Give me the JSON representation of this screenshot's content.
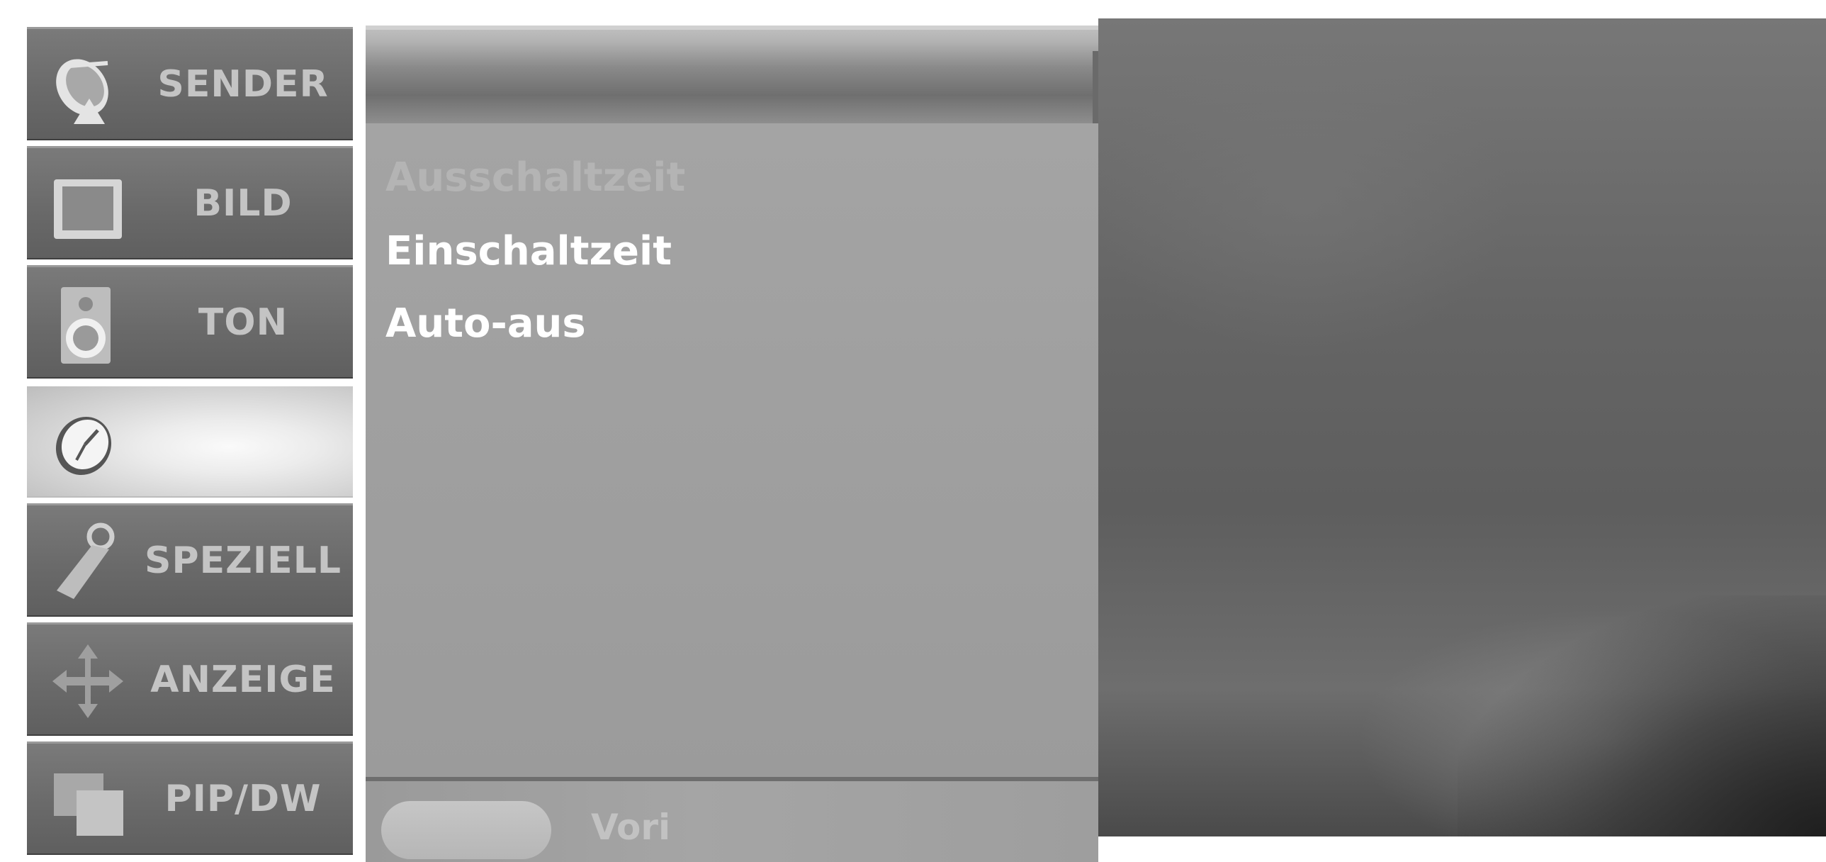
{
  "sidebar": {
    "items": [
      {
        "label": "SENDER",
        "icon": "satellite-dish-icon"
      },
      {
        "label": "BILD",
        "icon": "monitor-icon"
      },
      {
        "label": "TON",
        "icon": "speaker-icon"
      },
      {
        "label": "",
        "icon": "clock-icon",
        "active": true
      },
      {
        "label": "SPEZIELL",
        "icon": "key-tag-icon"
      },
      {
        "label": "ANZEIGE",
        "icon": "move-arrows-icon"
      },
      {
        "label": "PIP/DW",
        "icon": "pip-windows-icon"
      }
    ]
  },
  "panel": {
    "entries": [
      "Ausschaltzeit",
      "Einschaltzeit",
      "Auto-aus"
    ],
    "bottom_label": "Vori"
  },
  "colors": {
    "sidebar_item_bg": "#6a6a6a",
    "sidebar_active_bg": "#e6e6e6",
    "panel_bg": "#9e9e9e",
    "menu_text": "#ffffff",
    "preview_bg": "#656565"
  }
}
